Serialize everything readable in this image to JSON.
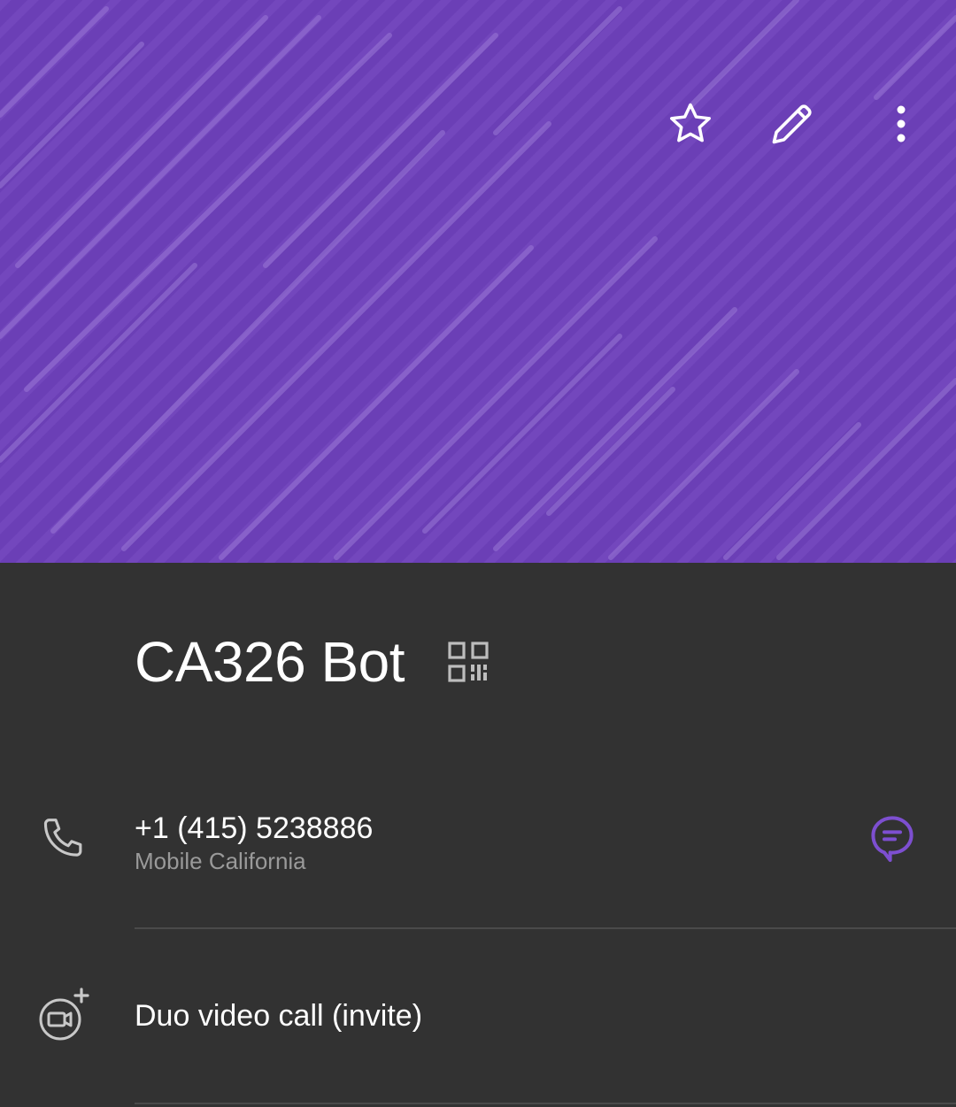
{
  "header": {
    "accent_color": "#6b3fb6",
    "actions": [
      {
        "icon": "star-outline-icon",
        "label": "Favorite"
      },
      {
        "icon": "pencil-icon",
        "label": "Edit"
      },
      {
        "icon": "more-vertical-icon",
        "label": "More options"
      }
    ]
  },
  "contact": {
    "name": "CA326 Bot",
    "qr_icon": "qr-code-icon"
  },
  "phone": {
    "icon": "phone-icon",
    "number": "+1 (415) 5238886",
    "type": "Mobile California",
    "message_icon": "message-icon"
  },
  "duo": {
    "icon": "duo-video-add-icon",
    "label": "Duo video call (invite)"
  }
}
